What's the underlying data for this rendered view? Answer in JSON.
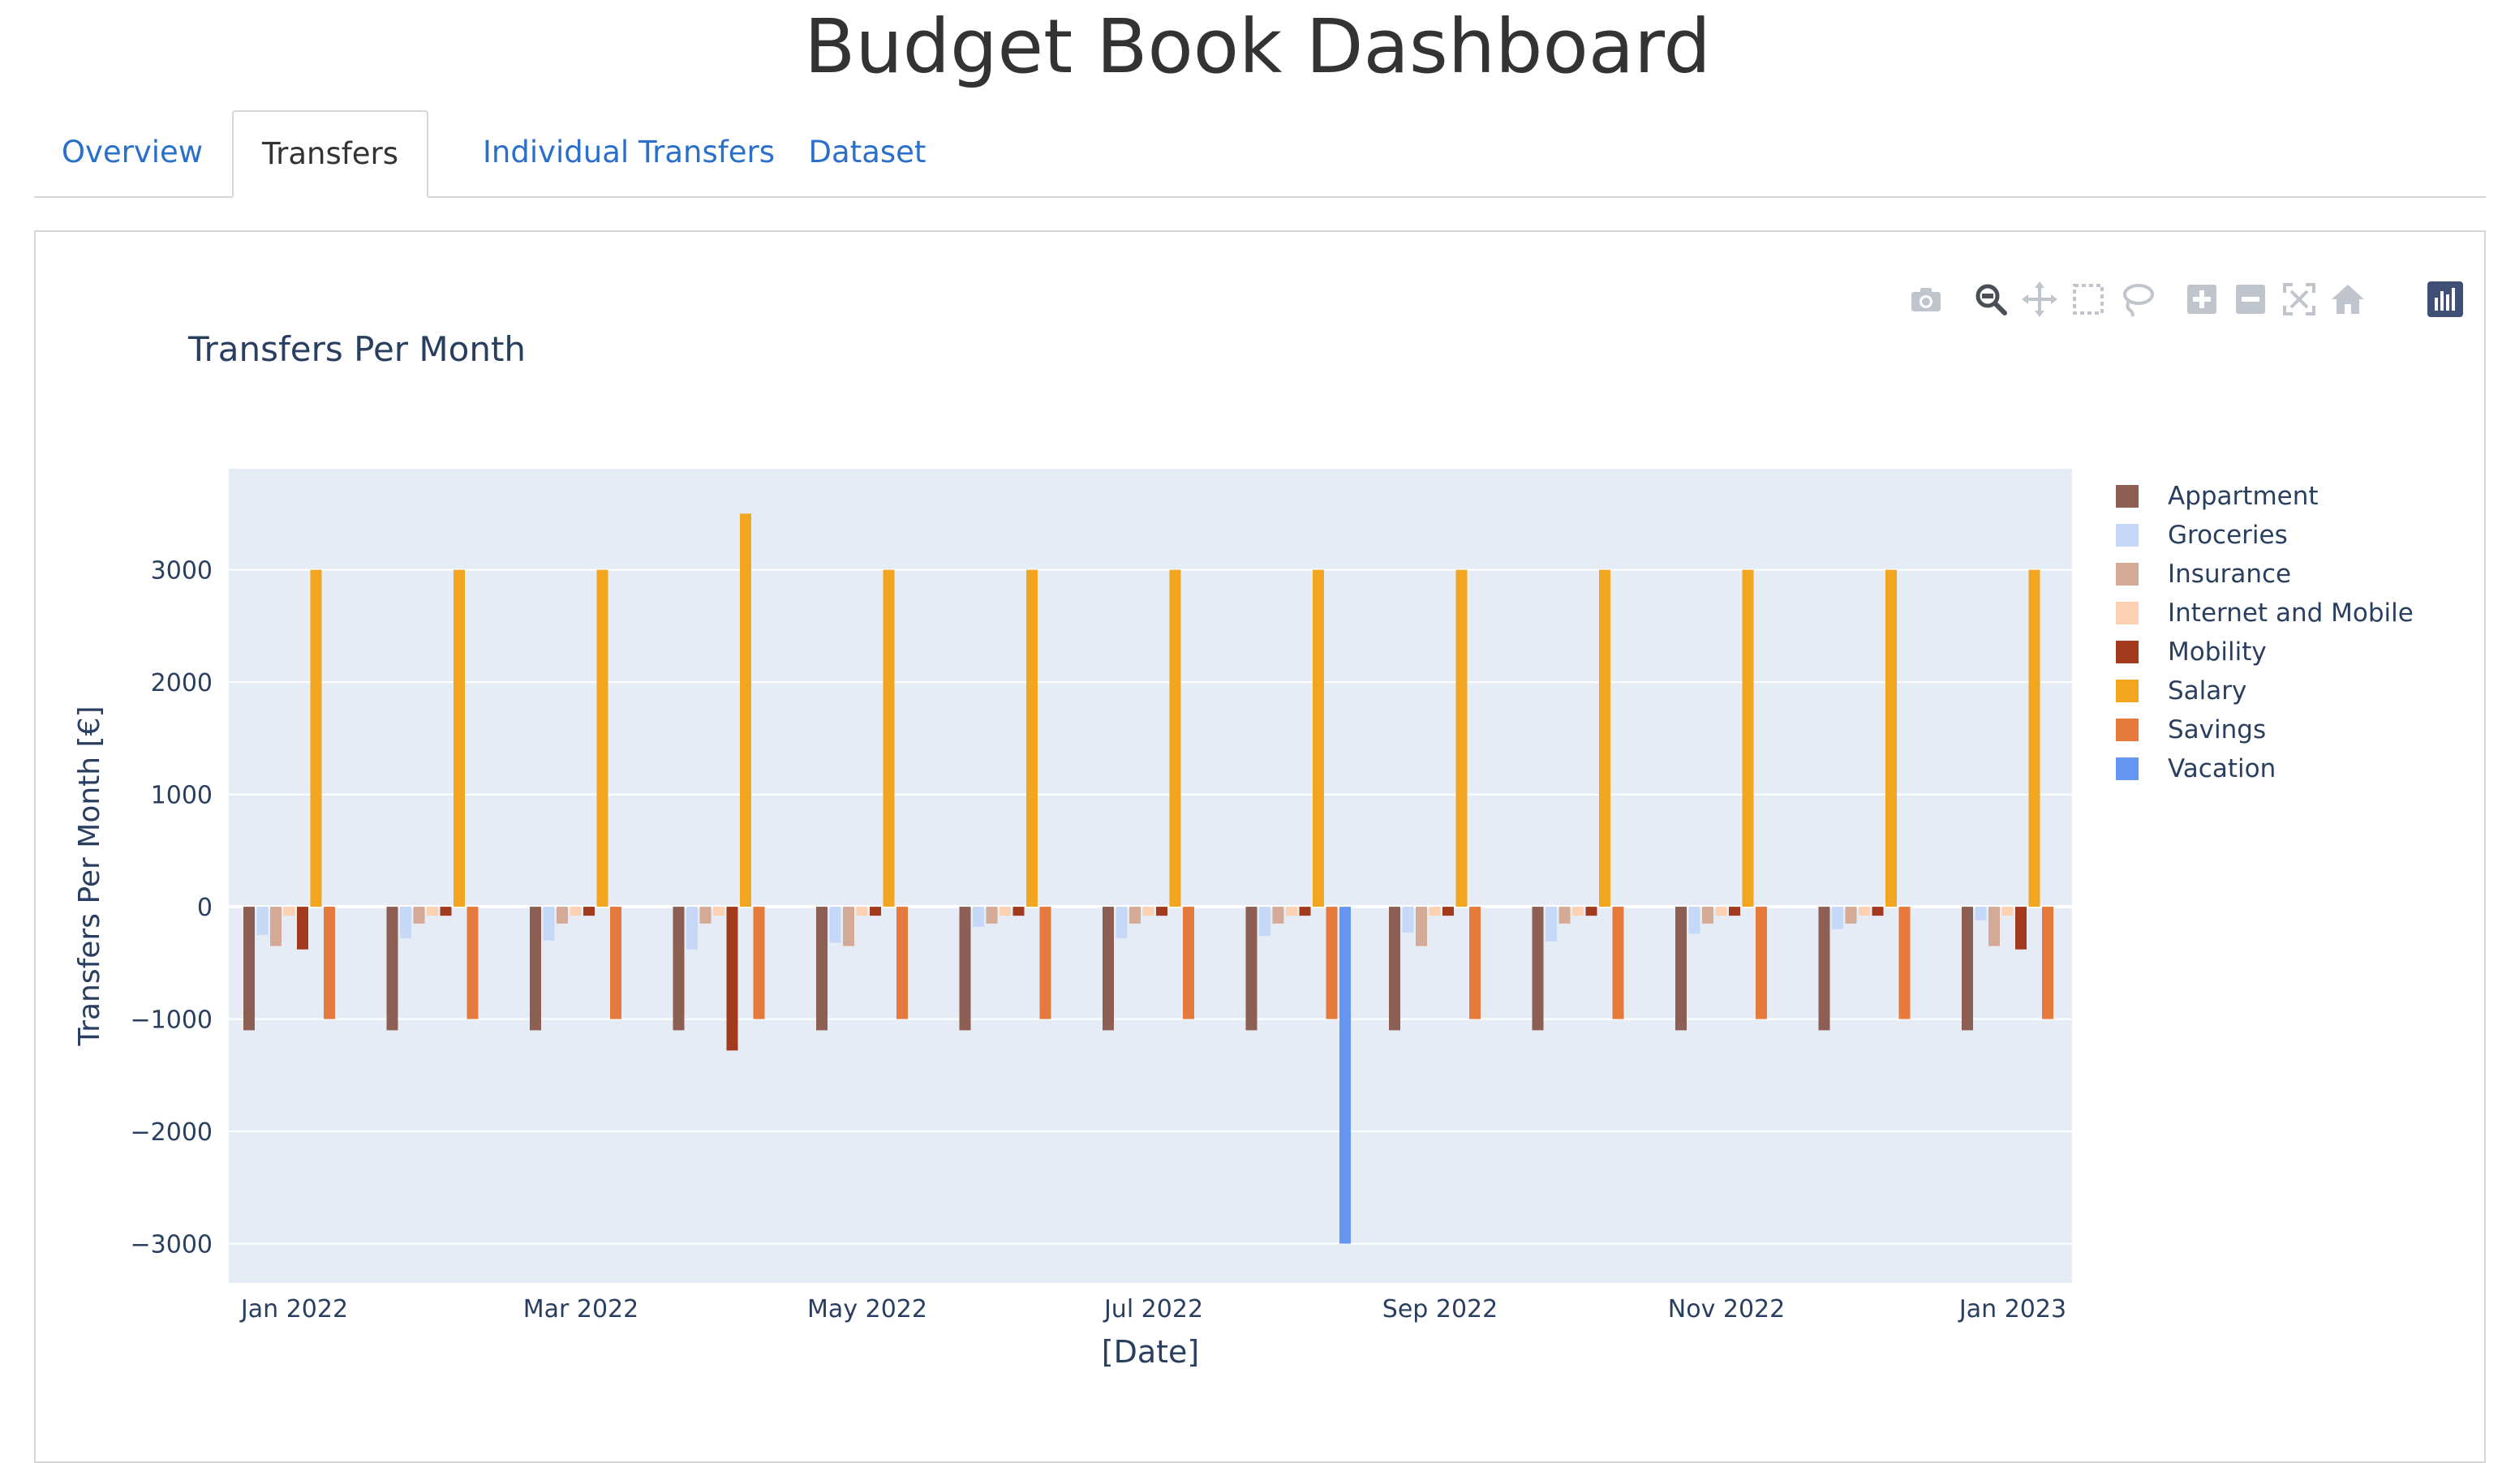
{
  "header": {
    "title": "Budget Book Dashboard"
  },
  "tabs": [
    {
      "label": "Overview",
      "active": false
    },
    {
      "label": "Transfers",
      "active": true
    },
    {
      "label": "Individual Transfers",
      "active": false
    },
    {
      "label": "Dataset",
      "active": false
    }
  ],
  "modebar": {
    "icons": [
      "camera-icon",
      "zoom-icon",
      "pan-icon",
      "box-select-icon",
      "lasso-select-icon",
      "zoom-in-icon",
      "zoom-out-icon",
      "autoscale-icon",
      "reset-axes-icon",
      "plotly-logo-icon"
    ]
  },
  "colors": {
    "plot_bg": "#e5ecf6",
    "Appartment": "#8c5f52",
    "Groceries": "#c6d8f7",
    "Insurance": "#d4a996",
    "Internet and Mobile": "#fdd0b1",
    "Mobility": "#a33a1e",
    "Salary": "#f2a51f",
    "Savings": "#e67a3c",
    "Vacation": "#6496f2"
  },
  "chart_data": {
    "type": "bar",
    "title": "Transfers Per Month",
    "xlabel": "[Date]",
    "ylabel": "Transfers Per Month [€]",
    "ylim": [
      -3350,
      3900
    ],
    "yticks": [
      {
        "value": 3000,
        "label": "3000"
      },
      {
        "value": 2000,
        "label": "2000"
      },
      {
        "value": 1000,
        "label": "1000"
      },
      {
        "value": 0,
        "label": "0"
      },
      {
        "value": -1000,
        "label": "−1000"
      },
      {
        "value": -2000,
        "label": "−2000"
      },
      {
        "value": -3000,
        "label": "−3000"
      }
    ],
    "xticks": [
      "Jan 2022",
      "Mar 2022",
      "May 2022",
      "Jul 2022",
      "Sep 2022",
      "Nov 2022",
      "Jan 2023"
    ],
    "grid": true,
    "legend_position": "right",
    "categories": [
      "2022-01",
      "2022-02",
      "2022-03",
      "2022-04",
      "2022-05",
      "2022-06",
      "2022-07",
      "2022-08",
      "2022-09",
      "2022-10",
      "2022-11",
      "2022-12",
      "2023-01"
    ],
    "series": [
      {
        "name": "Appartment",
        "values": [
          -1100,
          -1100,
          -1100,
          -1100,
          -1100,
          -1100,
          -1100,
          -1100,
          -1100,
          -1100,
          -1100,
          -1100,
          -1100
        ]
      },
      {
        "name": "Groceries",
        "values": [
          -250,
          -280,
          -300,
          -380,
          -320,
          -180,
          -280,
          -260,
          -230,
          -310,
          -240,
          -200,
          -120
        ]
      },
      {
        "name": "Insurance",
        "values": [
          -350,
          -150,
          -150,
          -150,
          -350,
          -150,
          -150,
          -150,
          -350,
          -150,
          -150,
          -150,
          -350
        ]
      },
      {
        "name": "Internet and Mobile",
        "values": [
          -80,
          -80,
          -80,
          -80,
          -80,
          -80,
          -80,
          -80,
          -80,
          -80,
          -80,
          -80,
          -80
        ]
      },
      {
        "name": "Mobility",
        "values": [
          -380,
          -80,
          -80,
          -1280,
          -80,
          -80,
          -80,
          -80,
          -80,
          -80,
          -80,
          -80,
          -380
        ]
      },
      {
        "name": "Salary",
        "values": [
          3000,
          3000,
          3000,
          3500,
          3000,
          3000,
          3000,
          3000,
          3000,
          3000,
          3000,
          3000,
          3000
        ]
      },
      {
        "name": "Savings",
        "values": [
          -1000,
          -1000,
          -1000,
          -1000,
          -1000,
          -1000,
          -1000,
          -1000,
          -1000,
          -1000,
          -1000,
          -1000,
          -1000
        ]
      },
      {
        "name": "Vacation",
        "values": [
          0,
          0,
          0,
          0,
          0,
          0,
          0,
          -3000,
          0,
          0,
          0,
          0,
          0
        ]
      }
    ]
  }
}
